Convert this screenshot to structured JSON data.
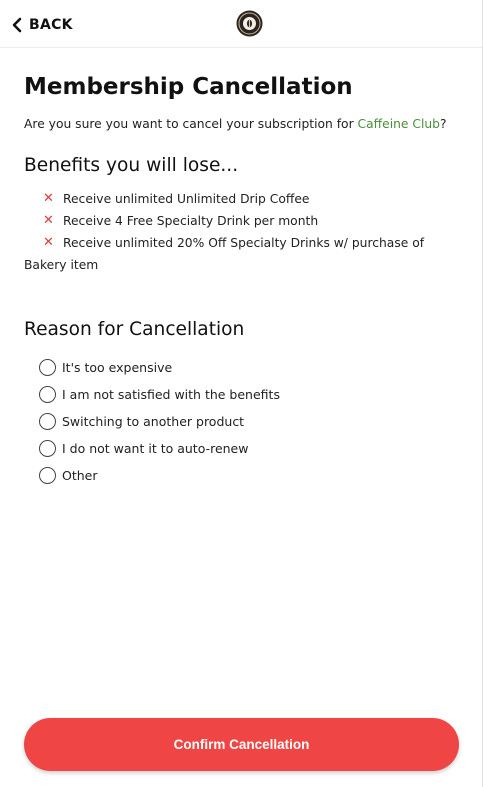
{
  "header": {
    "back_label": "BACK",
    "logo_icon": "coffee-brand-logo"
  },
  "page": {
    "title": "Membership Cancellation",
    "subtitle_prefix": "Are you sure you want to cancel your subscription for ",
    "club_name": "Caffeine Club",
    "subtitle_suffix": "?"
  },
  "benefits": {
    "heading": "Benefits you will lose...",
    "items": [
      "Receive unlimited Unlimited Drip Coffee",
      "Receive 4 Free Specialty Drink per month",
      "Receive unlimited 20% Off Specialty Drinks w/ purchase of Bakery item"
    ],
    "icon": "x-icon"
  },
  "reasons": {
    "heading": "Reason for Cancellation",
    "options": [
      "It's too expensive",
      "I am not satisfied with the benefits",
      "Switching to another product",
      "I do not want it to auto-renew",
      "Other"
    ]
  },
  "actions": {
    "confirm_label": "Confirm Cancellation"
  },
  "colors": {
    "accent_red": "#ef4545",
    "link_green": "#4a8f3a",
    "x_red": "#e03b3b"
  }
}
